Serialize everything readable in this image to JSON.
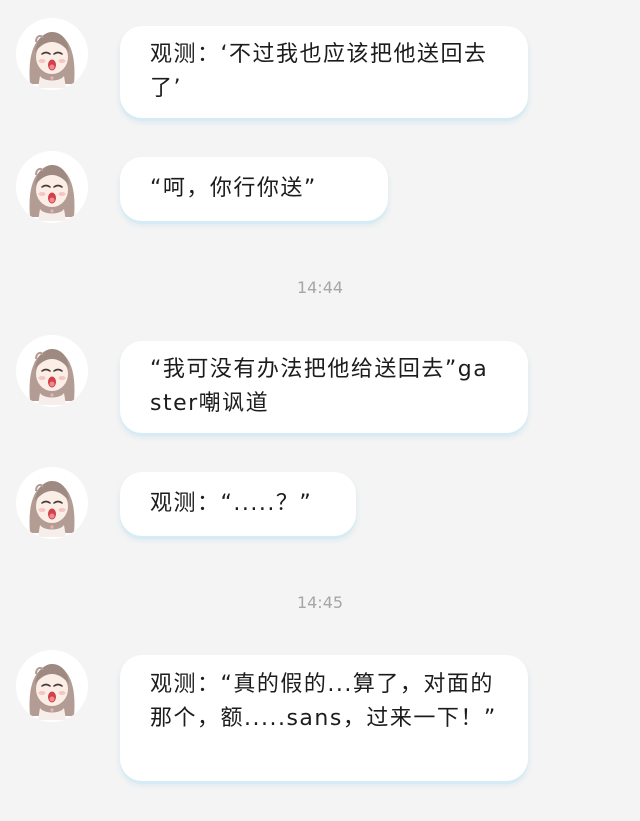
{
  "messages": [
    {
      "text": "观测：‘不过我也应该把他送回去了’"
    },
    {
      "text": "“呵，你行你送”"
    },
    {
      "text": "“我可没有办法把他给送回去”gaster嘲讽道"
    },
    {
      "text": "观测：“.....？”"
    },
    {
      "text": "观测：“真的假的...算了，对面的那个，额.....sans，过来一下！”"
    }
  ],
  "timestamps": [
    "14:44",
    "14:45"
  ],
  "avatar": {
    "icon": "girl-avatar-icon"
  },
  "colors": {
    "background": "#f4f4f4",
    "bubble": "#ffffff",
    "bubble_shadow": "#d6ecf4",
    "timestamp": "#a6a6a6",
    "text": "#1c1c1c"
  }
}
